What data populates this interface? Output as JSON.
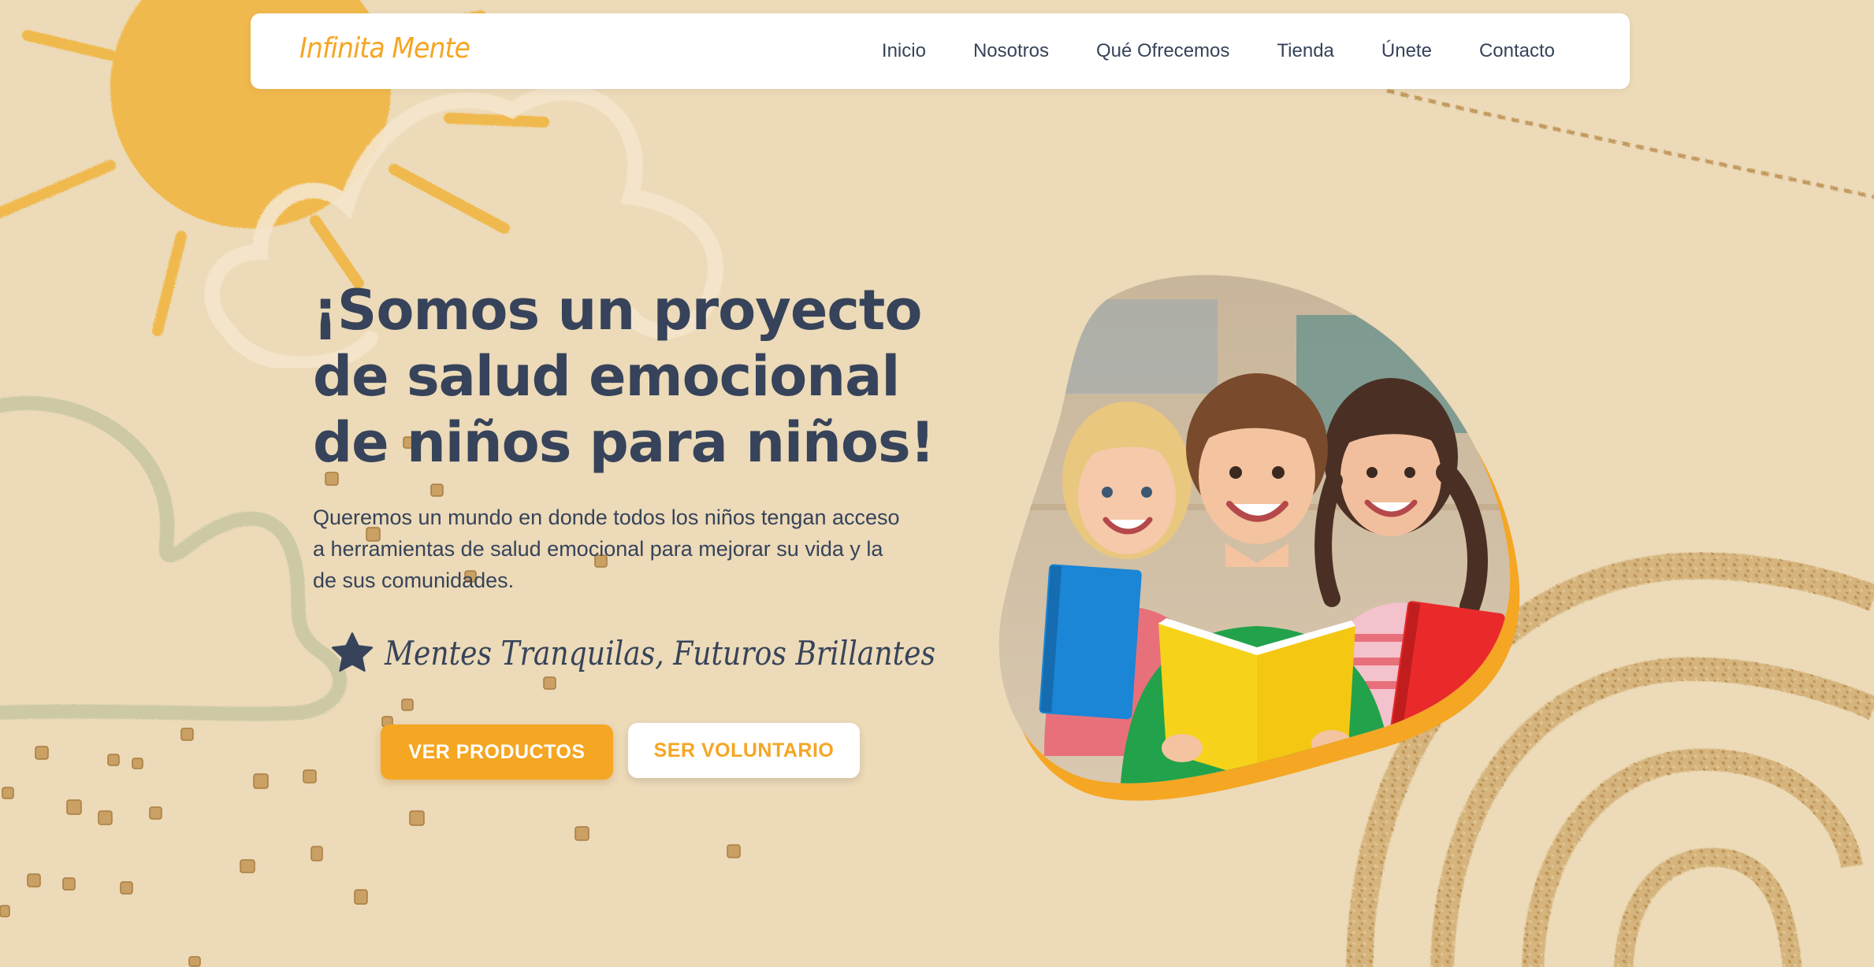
{
  "brand": {
    "name": "Infinita Mente",
    "color": "#f5a623"
  },
  "nav": {
    "items": [
      {
        "label": "Inicio"
      },
      {
        "label": "Nosotros"
      },
      {
        "label": "Qué Ofrecemos"
      },
      {
        "label": "Tienda"
      },
      {
        "label": "Únete"
      },
      {
        "label": "Contacto"
      }
    ]
  },
  "hero": {
    "title_lines": [
      "¡Somos un proyecto",
      "de salud emocional",
      "de niños para niños!"
    ],
    "description_lines": [
      "Queremos un mundo en donde todos los niños tengan acceso",
      "a herramientas de salud emocional para mejorar su vida y la",
      "de sus comunidades."
    ],
    "tagline": "Mentes Tranquilas, Futuros Brillantes",
    "primary_button": "VER PRODUCTOS",
    "secondary_button": "SER VOLUNTARIO",
    "image_subject": "three-children-holding-books"
  },
  "colors": {
    "background": "#ecdab8",
    "accent": "#f5a623",
    "text": "#36435a",
    "sun": "#f0b94e",
    "cloud_green": "#c9c8a2",
    "glitter": "#c9a063"
  },
  "icons": {
    "tagline_icon": "star-icon"
  }
}
